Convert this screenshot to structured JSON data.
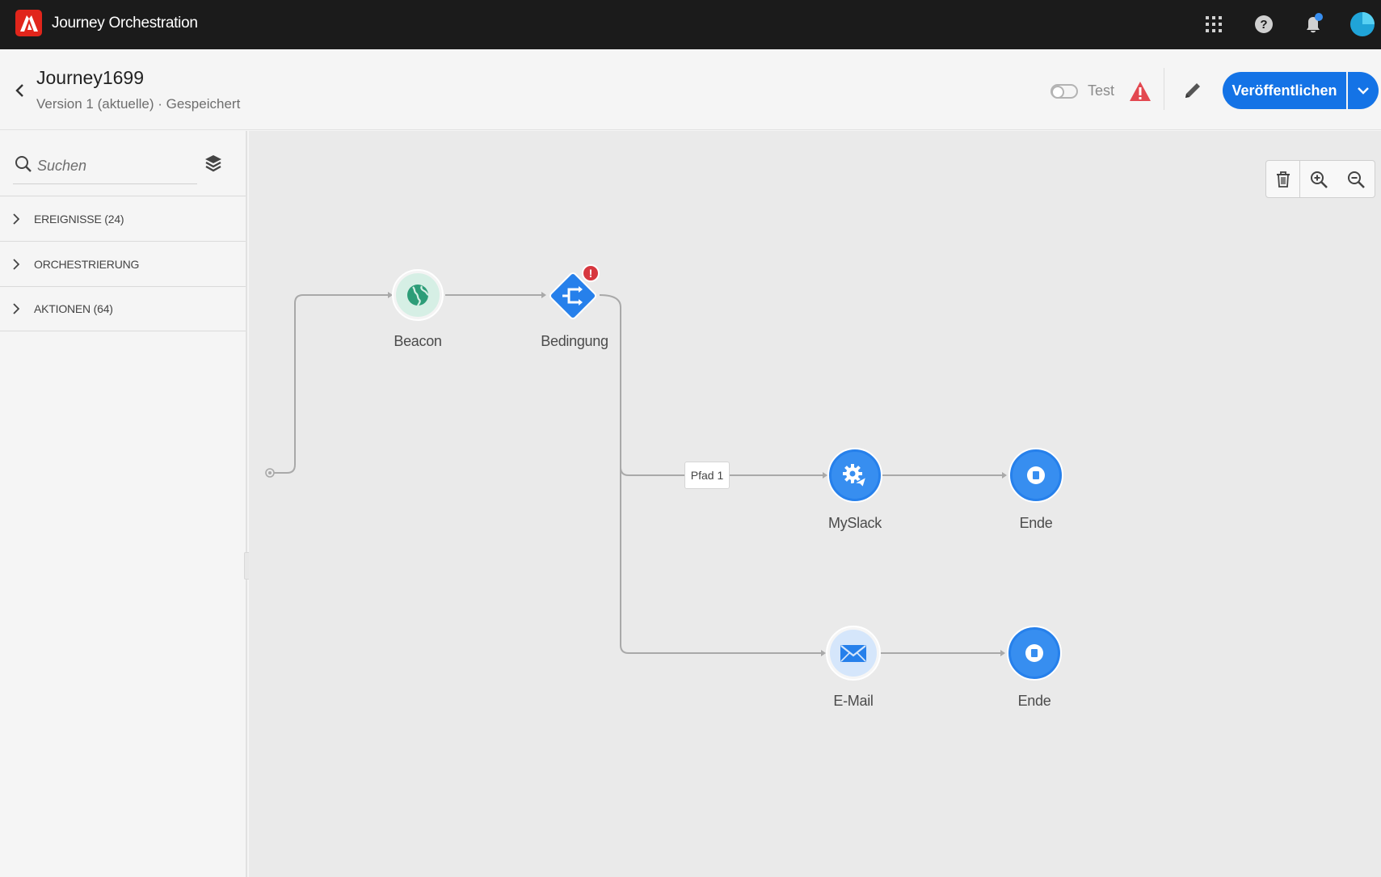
{
  "app": {
    "title": "Journey Orchestration"
  },
  "topbar": {
    "icons": [
      "apps-grid-icon",
      "help-icon",
      "notifications-icon",
      "user-avatar"
    ],
    "notification_dot_color": "#378ef0"
  },
  "header": {
    "back_icon": "chevron-left-icon",
    "journey_name": "Journey1699",
    "subtitle": "Version 1 (aktuelle) · Gespeichert",
    "test_label": "Test",
    "test_enabled": false,
    "warning_icon": "alert-triangle-icon",
    "edit_icon": "pencil-icon",
    "publish_label": "Veröffentlichen",
    "accent_color": "#1473e6"
  },
  "sidebar": {
    "search_placeholder": "Suchen",
    "categories": [
      {
        "label": "EREIGNISSE (24)"
      },
      {
        "label": "ORCHESTRIERUNG"
      },
      {
        "label": "AKTIONEN (64)"
      }
    ]
  },
  "canvas": {
    "tools": [
      "delete-icon",
      "zoom-in-icon",
      "zoom-out-icon"
    ],
    "nodes": {
      "beacon": {
        "label": "Beacon",
        "icon": "globe-icon"
      },
      "condition": {
        "label": "Bedingung",
        "icon": "split-arrows-icon",
        "error": "!"
      },
      "myslack": {
        "label": "MySlack",
        "icon": "gear-paperplane-icon"
      },
      "end1": {
        "label": "Ende",
        "icon": "stop-icon"
      },
      "email": {
        "label": "E-Mail",
        "icon": "envelope-icon"
      },
      "end2": {
        "label": "Ende",
        "icon": "stop-icon"
      }
    },
    "path_label": "Pfad 1"
  }
}
